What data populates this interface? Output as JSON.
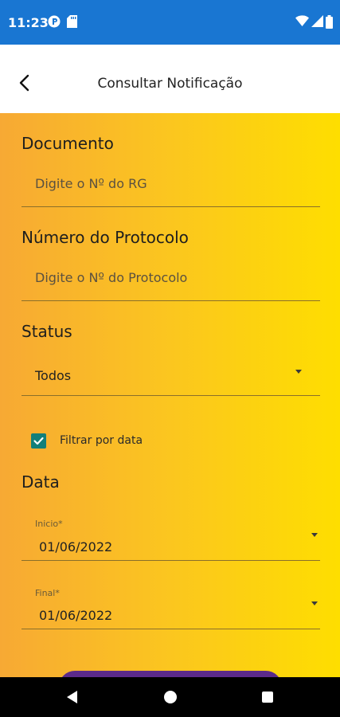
{
  "status_bar": {
    "time": "11:23",
    "icons": [
      "app-notification-icon",
      "sd-card-icon",
      "wifi-icon",
      "signal-icon",
      "battery-icon"
    ],
    "color": "#1976d2"
  },
  "app_bar": {
    "title": "Consultar Notificação",
    "back_icon": "back-arrow-icon"
  },
  "form": {
    "documento": {
      "label": "Documento",
      "placeholder": "Digite o Nº do RG"
    },
    "protocolo": {
      "label": "Número do Protocolo",
      "placeholder": "Digite o Nº do Protocolo"
    },
    "status": {
      "label": "Status",
      "value": "Todos"
    },
    "filter_by_date": {
      "label": "Filtrar por data",
      "checked": true
    },
    "data": {
      "label": "Data",
      "inicio": {
        "label": "Inicio*",
        "value": "01/06/2022"
      },
      "final": {
        "label": "Final*",
        "value": "01/06/2022"
      }
    }
  },
  "colors": {
    "gradient_start": "#f7a934",
    "gradient_end": "#fede00",
    "checkbox": "#127f7a",
    "button": "#5b2a8a"
  },
  "nav_bar": {
    "icons": [
      "nav-back-icon",
      "nav-home-icon",
      "nav-recent-apps-icon"
    ]
  }
}
